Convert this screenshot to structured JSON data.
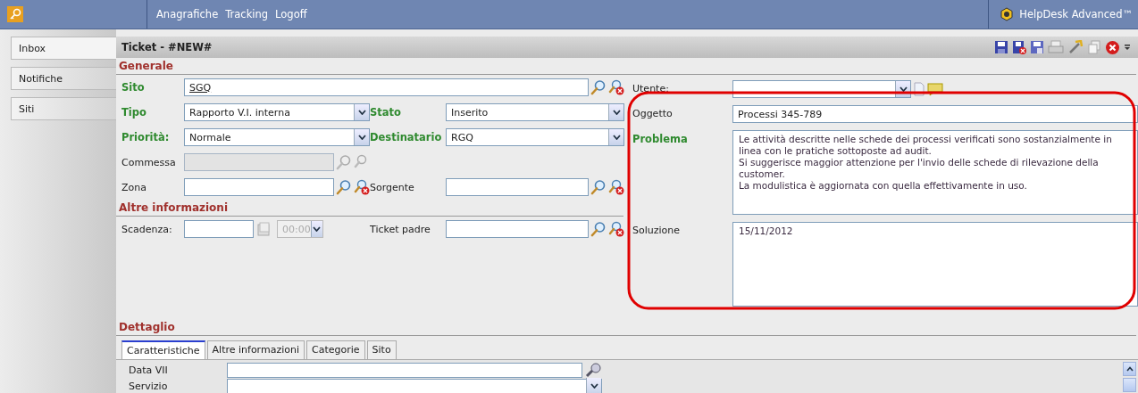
{
  "topbar": {
    "menu": [
      "Anagrafiche",
      "Tracking",
      "Logoff"
    ],
    "product": "HelpDesk Advanced™"
  },
  "sidebar": {
    "items": [
      {
        "label": "Inbox",
        "selected": true
      },
      {
        "label": "Notifiche",
        "selected": false
      },
      {
        "label": "Siti",
        "selected": false
      }
    ]
  },
  "ticket": {
    "title": "Ticket - #NEW#"
  },
  "generale": {
    "title": "Generale",
    "rows": [
      [
        {
          "label": "Sito",
          "required": true,
          "disabled": false,
          "kind": "lookup",
          "value": "SGQ",
          "linked": true
        }
      ],
      [
        {
          "label": "Tipo",
          "required": true,
          "disabled": false,
          "kind": "select",
          "value": "Rapporto V.I. interna"
        },
        {
          "label": "Stato",
          "required": true,
          "disabled": false,
          "kind": "select",
          "value": "Inserito"
        }
      ],
      [
        {
          "label": "Priorità:",
          "required": true,
          "disabled": false,
          "kind": "select",
          "value": "Normale"
        },
        {
          "label": "Destinatario",
          "required": true,
          "disabled": false,
          "kind": "select",
          "value": "RGQ"
        }
      ],
      [
        {
          "label": "Commessa",
          "required": false,
          "disabled": true,
          "kind": "lookup"
        }
      ],
      [
        {
          "label": "Zona",
          "required": false,
          "disabled": false,
          "kind": "lookup"
        },
        {
          "label": "Sorgente",
          "required": false,
          "disabled": false,
          "kind": "lookup"
        }
      ]
    ],
    "right": [
      {
        "label": "Utente:",
        "required": false,
        "disabled": false,
        "kind": "user"
      },
      {
        "label": "Oggetto",
        "required": false,
        "disabled": false,
        "kind": "text",
        "value": "Processi 345-789"
      },
      {
        "label": "Problema",
        "required": true,
        "disabled": false,
        "kind": "textarea",
        "value": "Le attività descritte nelle schede dei processi verificati sono sostanzialmente in linea con le pratiche sottoposte ad audit.\nSi suggerisce maggior attenzione per l'invio delle schede di rilevazione della customer.\nLa modulistica è aggiornata con quella effettivamente in uso."
      },
      {
        "label": "Soluzione",
        "required": false,
        "disabled": false,
        "kind": "textarea",
        "value": "15/11/2012"
      }
    ]
  },
  "altre_informazioni": {
    "title": "Altre informazioni",
    "rows": [
      [
        {
          "label": "Scadenza:",
          "required": false,
          "disabled": false,
          "kind": "date",
          "time": {
            "value": "00:00",
            "disabled": true
          }
        },
        {
          "label": "Ticket padre",
          "required": false,
          "disabled": false,
          "kind": "lookup"
        }
      ]
    ]
  },
  "dettaglio": {
    "title": "Dettaglio",
    "tabs": [
      {
        "label": "Caratteristiche",
        "selected": true
      },
      {
        "label": "Altre informazioni",
        "selected": false
      },
      {
        "label": "Categorie",
        "selected": false
      },
      {
        "label": "Sito",
        "selected": false
      }
    ],
    "fields": [
      {
        "label": "Data VII",
        "kind": "datepicker"
      },
      {
        "label": "Servizio",
        "kind": "select"
      }
    ]
  }
}
